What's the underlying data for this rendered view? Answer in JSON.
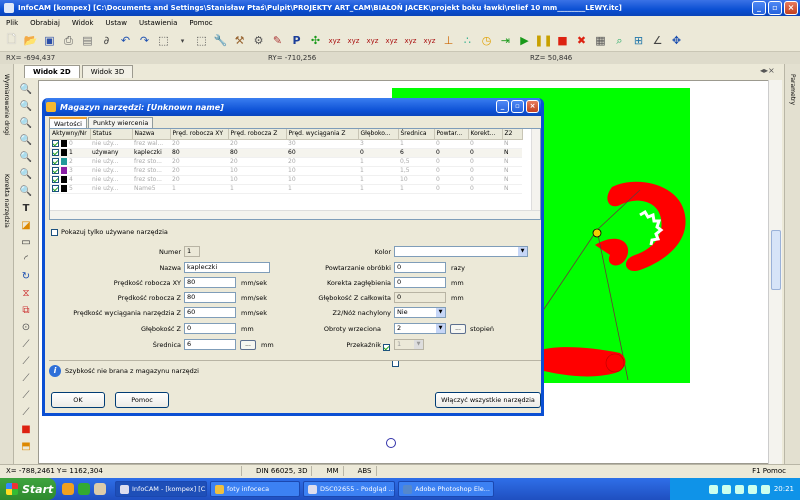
{
  "window": {
    "title": "InfoCAM  [kompex] [C:\\Documents and Settings\\Stanisław Ptaś\\Pulpit\\PROJEKTY ART_CAM\\BIAŁOŃ JACEK\\projekt boku ławki\\relief 10  mm________LEWY.itc]"
  },
  "menu": [
    "Plik",
    "Obrabiaj",
    "Widok",
    "Ustaw",
    "Ustawienia",
    "Pomoc"
  ],
  "coords": {
    "rx": "RX= -694,437",
    "ry": "RY= -710,256",
    "rz": "RZ= 50,846"
  },
  "view_tabs": [
    "Widok 2D",
    "Widok 3D"
  ],
  "left_panel": {
    "label1": "Wymiarowanie drogi",
    "label2": "Korekta narzędzia"
  },
  "right_panel": {
    "label": "Parametry"
  },
  "dialog": {
    "title": "Magazyn narzędzi: [Unknown name]",
    "tabs": [
      "Wartości",
      "Punkty wiercenia"
    ],
    "table": {
      "headers": [
        "Aktywny/Nr",
        "Status",
        "Nazwa",
        "Pręd. robocza XY",
        "Pręd. robocza Z",
        "Pręd. wyciągania Z",
        "Głęboko...",
        "Średnica",
        "Powtar...",
        "Korekt...",
        "Z2"
      ],
      "rows": [
        {
          "nr": "0",
          "status": "nie uży...",
          "name": "frez wal...",
          "xy": "20",
          "z": "20",
          "wz": "30",
          "depth": "3",
          "dia": "1",
          "rep": "0",
          "corr": "0",
          "z2": "N",
          "color": "#000000",
          "used": false
        },
        {
          "nr": "1",
          "status": "używany",
          "name": "kapleczki",
          "xy": "80",
          "z": "80",
          "wz": "60",
          "depth": "0",
          "dia": "6",
          "rep": "0",
          "corr": "0",
          "z2": "N",
          "color": "#000000",
          "used": true
        },
        {
          "nr": "2",
          "status": "nie uży...",
          "name": "frez sto...",
          "xy": "20",
          "z": "20",
          "wz": "20",
          "depth": "1",
          "dia": "0,5",
          "rep": "0",
          "corr": "0",
          "z2": "N",
          "color": "#1f9a9a",
          "used": false
        },
        {
          "nr": "3",
          "status": "nie uży...",
          "name": "frez sto...",
          "xy": "20",
          "z": "10",
          "wz": "10",
          "depth": "1",
          "dia": "1,5",
          "rep": "0",
          "corr": "0",
          "z2": "N",
          "color": "#8a1fa6",
          "used": false
        },
        {
          "nr": "4",
          "status": "nie uży...",
          "name": "frez sto...",
          "xy": "20",
          "z": "10",
          "wz": "10",
          "depth": "1",
          "dia": "10",
          "rep": "0",
          "corr": "0",
          "z2": "N",
          "color": "#000000",
          "used": false
        },
        {
          "nr": "5",
          "status": "nie uży...",
          "name": "Name5",
          "xy": "1",
          "z": "1",
          "wz": "1",
          "depth": "1",
          "dia": "1",
          "rep": "0",
          "corr": "0",
          "z2": "N",
          "color": "#000000",
          "used": false
        }
      ]
    },
    "show_used_only": "Pokazuj tylko używane narzędzia",
    "form": {
      "numer": {
        "label": "Numer",
        "value": "1"
      },
      "nazwa": {
        "label": "Nazwa",
        "value": "kapleczki"
      },
      "xy": {
        "label": "Prędkość robocza XY",
        "value": "80",
        "unit": "mm/sek"
      },
      "z": {
        "label": "Prędkość robocza Z",
        "value": "80",
        "unit": "mm/sek"
      },
      "wz": {
        "label": "Prędkość wyciągania narzędzia Z",
        "value": "60",
        "unit": "mm/sek"
      },
      "gl": {
        "label": "Głębokość Z",
        "value": "0",
        "unit": "mm"
      },
      "sr": {
        "label": "Średnica",
        "value": "6",
        "unit": "mm",
        "btn": "..."
      },
      "kolor": {
        "label": "Kolor"
      },
      "powt": {
        "label": "Powtarzanie obróbki",
        "value": "0",
        "unit": "razy"
      },
      "kor": {
        "label": "Korekta zagłębienia",
        "value": "0",
        "unit": "mm"
      },
      "glc": {
        "label": "Głębokość Z całkowita",
        "value": "0",
        "unit": "mm"
      },
      "z2": {
        "label": "Z2/Nóż nachylony",
        "value": "Nie"
      },
      "obr": {
        "label": "Obroty wrzeciona",
        "value": "2",
        "unit": "stopień",
        "btn": "..."
      },
      "prz": {
        "label": "Przekaźnik",
        "value": "1"
      }
    },
    "info": "Szybkość nie brana z magazynu narzędzi",
    "buttons": {
      "ok": "OK",
      "cancel": "Pomoc",
      "enable_all": "Włączyć wszystkie narzędzia"
    }
  },
  "status": {
    "coords": "X= -788,2461 Y= 1162,304",
    "din": "DIN 66025, 3D",
    "mm": "MM",
    "abs": "ABS",
    "help": "F1 Pomoc"
  },
  "taskbar": {
    "start": "Start",
    "tasks": [
      "InfoCAM - [kompex] [C...",
      "foty infoceca",
      "DSC02655 - Podgląd ...",
      "Adobe Photoshop Ele..."
    ],
    "clock": "20:21"
  },
  "colors": {
    "canvas_green": "#00ff00",
    "relief_red": "#ff0000",
    "titlebar": "#0b4fd3"
  }
}
